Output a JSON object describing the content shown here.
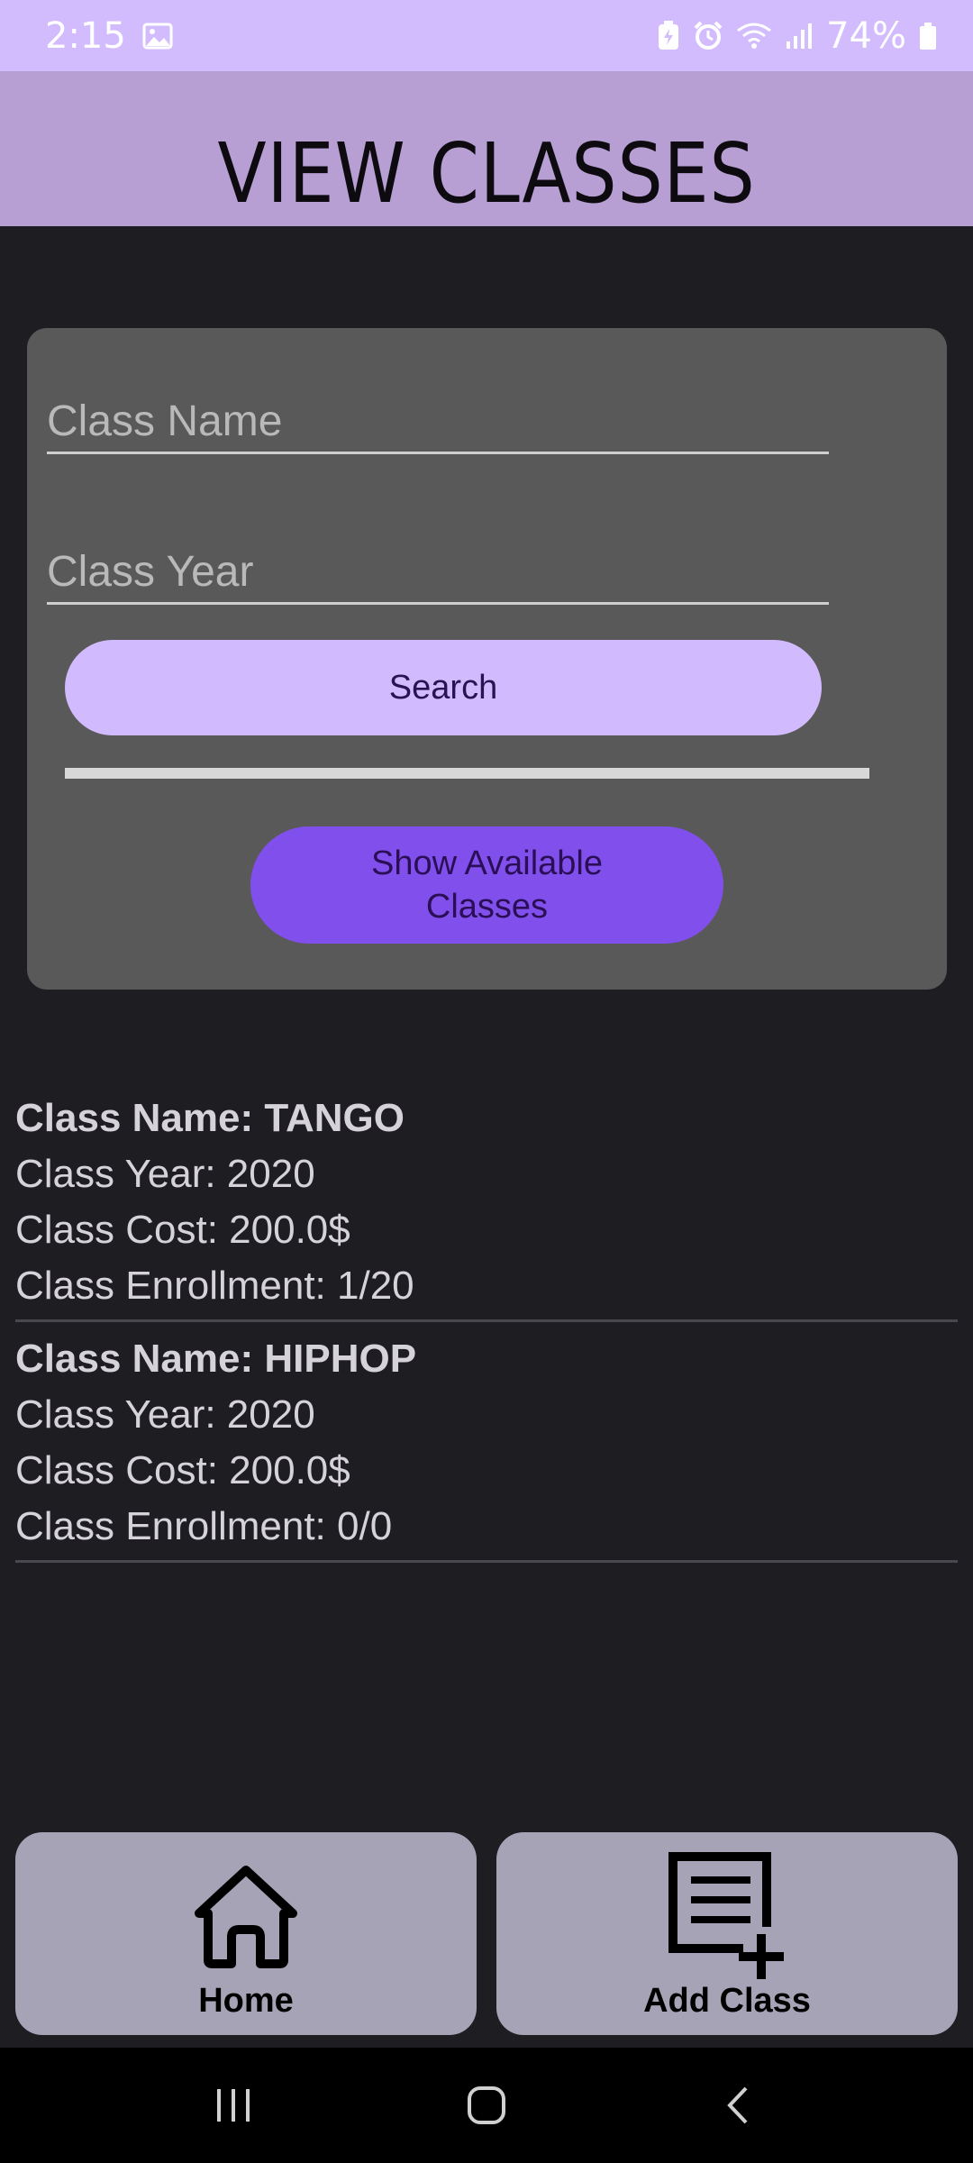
{
  "status_bar": {
    "time": "2:15",
    "battery": "74%",
    "icons": [
      "image-icon",
      "battery-saver-icon",
      "alarm-icon",
      "wifi-icon",
      "signal-icon",
      "battery-icon"
    ]
  },
  "header": {
    "title": "VIEW CLASSES"
  },
  "search": {
    "name_placeholder": "Class Name",
    "year_placeholder": "Class Year",
    "search_label": "Search",
    "show_label": "Show Available\nClasses"
  },
  "classes": [
    {
      "name": "Class Name: TANGO",
      "year": "Class Year: 2020",
      "cost": "Class Cost: 200.0$",
      "enrollment": "Class Enrollment: 1/20"
    },
    {
      "name": "Class Name: HIPHOP",
      "year": "Class Year: 2020",
      "cost": "Class Cost: 200.0$",
      "enrollment": "Class Enrollment: 0/0"
    }
  ],
  "bottom_bar": {
    "home_label": "Home",
    "add_label": "Add Class"
  },
  "colors": {
    "status_bar": "#d2bcfe",
    "header": "#b79fd4",
    "background": "#1e1d22",
    "card": "#595959",
    "search_button": "#d1bbfe",
    "show_button": "#8150ec",
    "bottom_button": "#a6a3b7"
  }
}
